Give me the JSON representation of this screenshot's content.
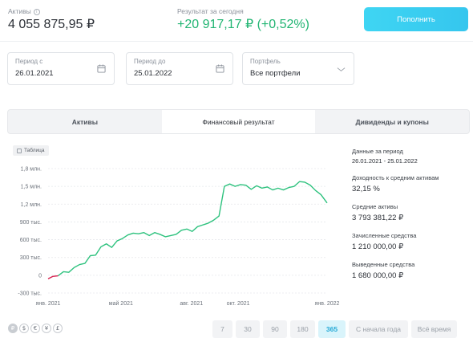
{
  "header": {
    "assets_label": "Активы",
    "assets_value": "4 055 875,95 ₽",
    "result_label": "Результат за сегодня",
    "result_value": "+20 917,17 ₽ (+0,52%)",
    "topup_label": "Пополнить"
  },
  "filters": {
    "period_from_label": "Период с",
    "period_from_value": "26.01.2021",
    "period_to_label": "Период до",
    "period_to_value": "25.01.2022",
    "portfolio_label": "Портфель",
    "portfolio_value": "Все портфели"
  },
  "tabs": [
    {
      "label": "Активы"
    },
    {
      "label": "Финансовый результат"
    },
    {
      "label": "Дивиденды и купоны"
    }
  ],
  "table_toggle_label": "Таблица",
  "stats": {
    "range_label": "Данные за период",
    "range_value": "26.01.2021 - 25.01.2022",
    "yield_label": "Доходность к средним активам",
    "yield_value": "32,15 %",
    "avg_label": "Средние активы",
    "avg_value": "3 793 381,22 ₽",
    "deposit_label": "Зачисленные средства",
    "deposit_value": "1 210 000,00 ₽",
    "withdraw_label": "Выведенные средства",
    "withdraw_value": "1 680 000,00 ₽"
  },
  "currencies": [
    "₽",
    "$",
    "€",
    "¥",
    "£"
  ],
  "periods": [
    "7",
    "30",
    "90",
    "180",
    "365",
    "С начала года",
    "Всё время"
  ],
  "active_period": "365",
  "colors": {
    "line": "#2ec27e",
    "negative": "#d6204e",
    "accent": "#36c8ef"
  },
  "chart_data": {
    "type": "line",
    "ytick_labels": [
      "1,8 млн.",
      "1,5 млн.",
      "1,2 млн.",
      "900 тыс.",
      "600 тыс.",
      "300 тыс.",
      "0",
      "-300 тыс."
    ],
    "yticks": [
      1800000,
      1500000,
      1200000,
      900000,
      600000,
      300000,
      0,
      -300000
    ],
    "ylim": [
      -300000,
      1800000
    ],
    "xtick_labels": [
      "янв. 2021",
      "май 2021",
      "авг. 2021",
      "окт. 2021",
      "янв. 2022"
    ],
    "xticks": [
      "2021-01-26",
      "2021-05-01",
      "2021-08-01",
      "2021-10-01",
      "2022-01-25"
    ],
    "xlim": [
      "2021-01-26",
      "2022-01-25"
    ],
    "series": [
      {
        "x": [
          "2021-01-26",
          "2021-02-01",
          "2021-02-08",
          "2021-02-15",
          "2021-02-22",
          "2021-03-01",
          "2021-03-08",
          "2021-03-15",
          "2021-03-22",
          "2021-03-29",
          "2021-04-05",
          "2021-04-12",
          "2021-04-19",
          "2021-04-26",
          "2021-05-03",
          "2021-05-10",
          "2021-05-17",
          "2021-05-24",
          "2021-05-31",
          "2021-06-07",
          "2021-06-14",
          "2021-06-21",
          "2021-06-28",
          "2021-07-05",
          "2021-07-12",
          "2021-07-19",
          "2021-07-26",
          "2021-08-02",
          "2021-08-09",
          "2021-08-16",
          "2021-08-23",
          "2021-08-30",
          "2021-09-06",
          "2021-09-13",
          "2021-09-20",
          "2021-09-27",
          "2021-10-04",
          "2021-10-11",
          "2021-10-18",
          "2021-10-25",
          "2021-11-01",
          "2021-11-08",
          "2021-11-15",
          "2021-11-22",
          "2021-11-29",
          "2021-12-06",
          "2021-12-13",
          "2021-12-20",
          "2021-12-27",
          "2022-01-03",
          "2022-01-10",
          "2022-01-17",
          "2022-01-25"
        ],
        "y": [
          -60000,
          -20000,
          -10000,
          60000,
          50000,
          130000,
          180000,
          200000,
          330000,
          340000,
          480000,
          530000,
          470000,
          580000,
          620000,
          680000,
          710000,
          700000,
          720000,
          670000,
          720000,
          690000,
          650000,
          670000,
          690000,
          760000,
          780000,
          740000,
          820000,
          850000,
          880000,
          930000,
          1000000,
          1500000,
          1540000,
          1500000,
          1530000,
          1520000,
          1450000,
          1510000,
          1470000,
          1490000,
          1440000,
          1470000,
          1440000,
          1480000,
          1500000,
          1580000,
          1570000,
          1520000,
          1430000,
          1360000,
          1220000
        ]
      }
    ],
    "negative_until": "2021-02-08",
    "grid": true,
    "legend": "none"
  }
}
